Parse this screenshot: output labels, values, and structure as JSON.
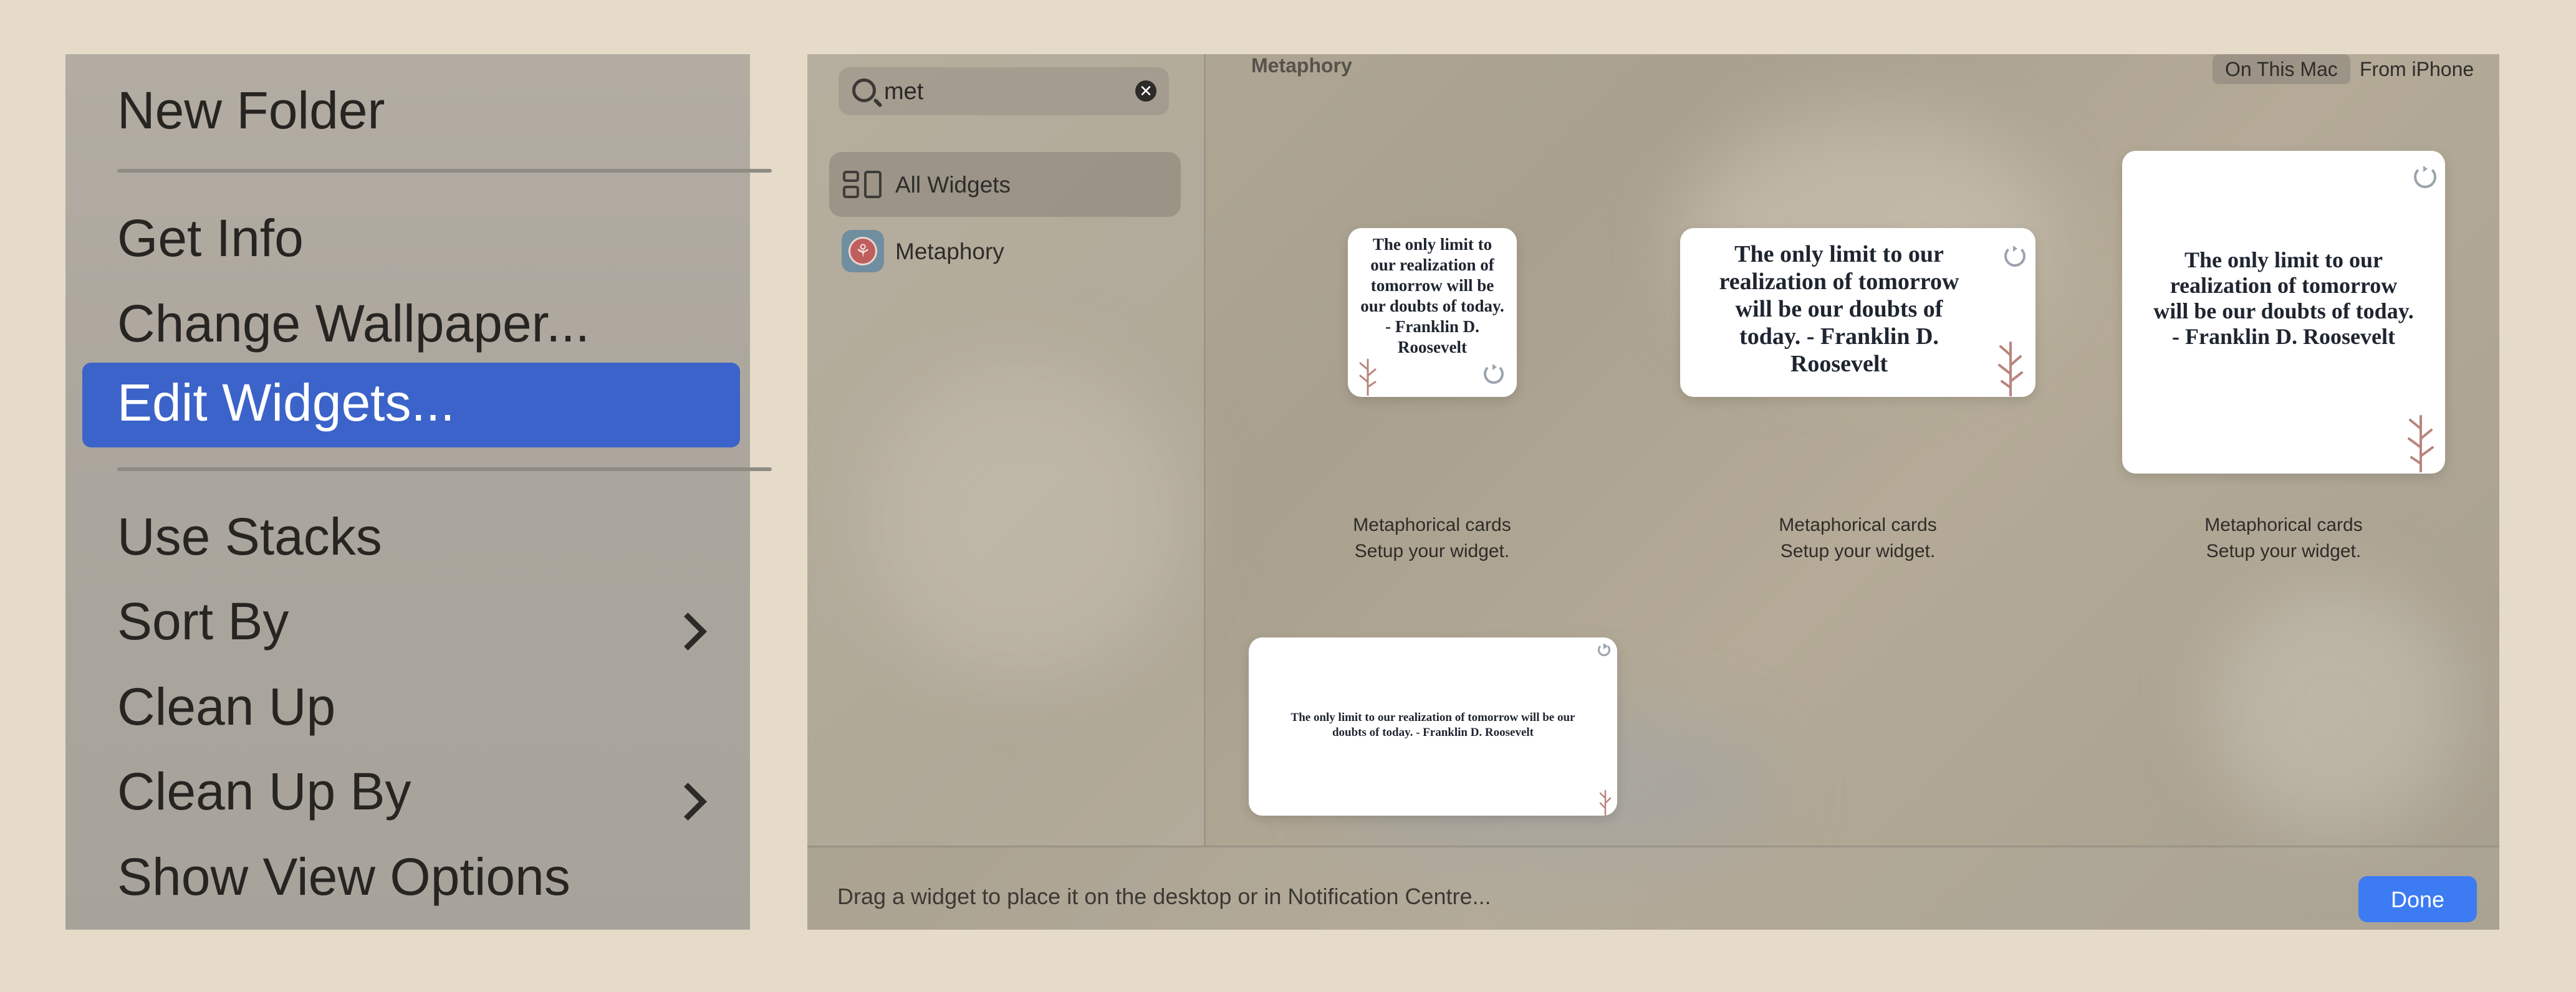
{
  "context_menu": {
    "items": [
      {
        "label": "New Folder"
      },
      {
        "label": "Get Info"
      },
      {
        "label": "Change Wallpaper..."
      },
      {
        "label": "Edit Widgets...",
        "highlighted": true
      },
      {
        "label": "Use Stacks"
      },
      {
        "label": "Sort By",
        "submenu": true
      },
      {
        "label": "Clean Up"
      },
      {
        "label": "Clean Up By",
        "submenu": true
      },
      {
        "label": "Show View Options"
      }
    ],
    "highlight_color": "#3b63c9"
  },
  "gallery": {
    "search": {
      "value": "met"
    },
    "sidebar": {
      "items": [
        {
          "label": "All Widgets",
          "selected": true,
          "icon": "widgets-grid-icon"
        },
        {
          "label": "Metaphory",
          "selected": false,
          "icon": "metaphory-app-icon"
        }
      ]
    },
    "header": {
      "title": "Metaphory",
      "source_toggle": {
        "on_this_mac": "On This Mac",
        "from_iphone": "From iPhone",
        "selected": "On This Mac"
      }
    },
    "widgets": [
      {
        "size": "small",
        "quote": "The only limit to our realization of tomorrow will be our doubts of today. - Franklin D. Roosevelt",
        "caption_title": "Metaphorical cards",
        "caption_subtitle": "Setup your widget."
      },
      {
        "size": "medium",
        "quote": "The only limit to our realization of tomorrow will be our doubts of today. - Franklin D. Roosevelt",
        "caption_title": "Metaphorical cards",
        "caption_subtitle": "Setup your widget."
      },
      {
        "size": "large",
        "quote": "The only limit to our realization of tomorrow will be our doubts of today. - Franklin D. Roosevelt",
        "caption_title": "Metaphorical cards",
        "caption_subtitle": "Setup your widget."
      },
      {
        "size": "extra-large",
        "quote": "The only limit to our realization of tomorrow will be our doubts of today. - Franklin D. Roosevelt"
      }
    ],
    "footer": {
      "message": "Drag a widget to place it on the desktop or in Notification Centre...",
      "done_label": "Done"
    },
    "accent_color": "#3d7bf2"
  }
}
